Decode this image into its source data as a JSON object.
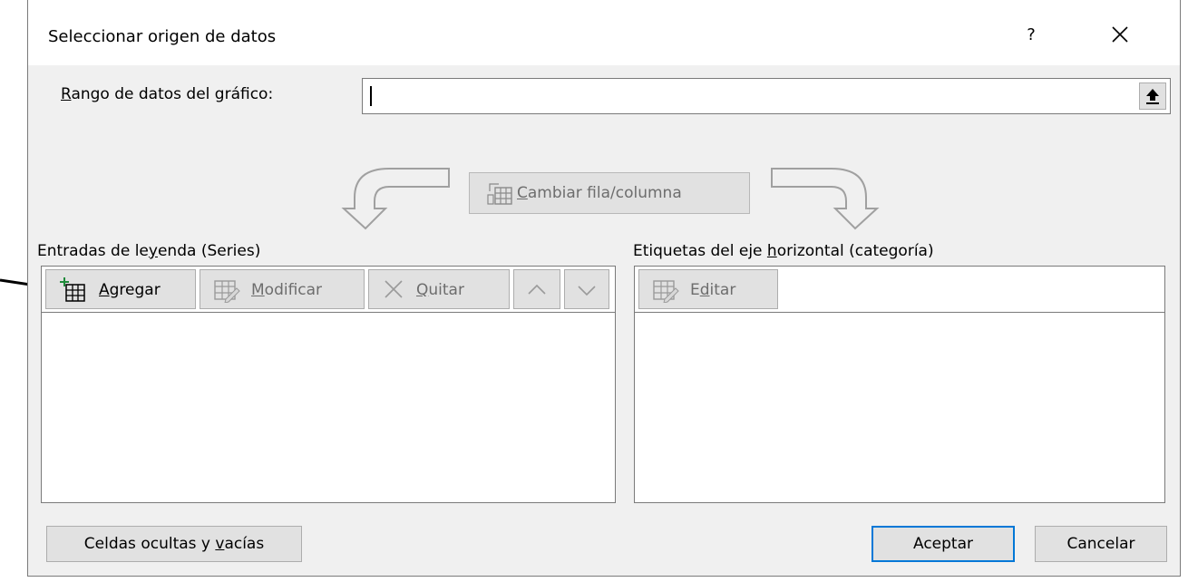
{
  "dialog": {
    "title": "Seleccionar origen de datos",
    "help_label": "?",
    "close_icon": "close-icon"
  },
  "range": {
    "label_prefix": "R",
    "label_rest": "ango de datos del gráfico:",
    "value": "",
    "collapse_icon": "collapse-upload-icon"
  },
  "swap": {
    "label_prefix": "C",
    "label_rest": "ambiar fila/columna",
    "enabled": false
  },
  "series_panel": {
    "label_pre": "Entradas de le",
    "label_accel": "y",
    "label_post": "enda (Series)",
    "add": {
      "accel": "A",
      "rest": "gregar"
    },
    "edit": {
      "accel": "M",
      "rest": "odificar"
    },
    "remove": {
      "accel": "Q",
      "rest": "uitar"
    },
    "items": []
  },
  "category_panel": {
    "label_pre": "Etiquetas del eje ",
    "label_accel": "h",
    "label_post": "orizontal (categoría)",
    "edit": {
      "pre": "E",
      "accel": "d",
      "rest": "itar"
    },
    "items": []
  },
  "footer": {
    "hidden_cells_pre": "Celdas ocultas y ",
    "hidden_cells_accel": "v",
    "hidden_cells_post": "acías",
    "ok_label": "Aceptar",
    "cancel_label": "Cancelar"
  },
  "colors": {
    "dialog_bg": "#f0f0f0",
    "button_bg": "#e1e1e1",
    "disabled_text": "#6d6d6d",
    "focus_border": "#0078d7"
  }
}
